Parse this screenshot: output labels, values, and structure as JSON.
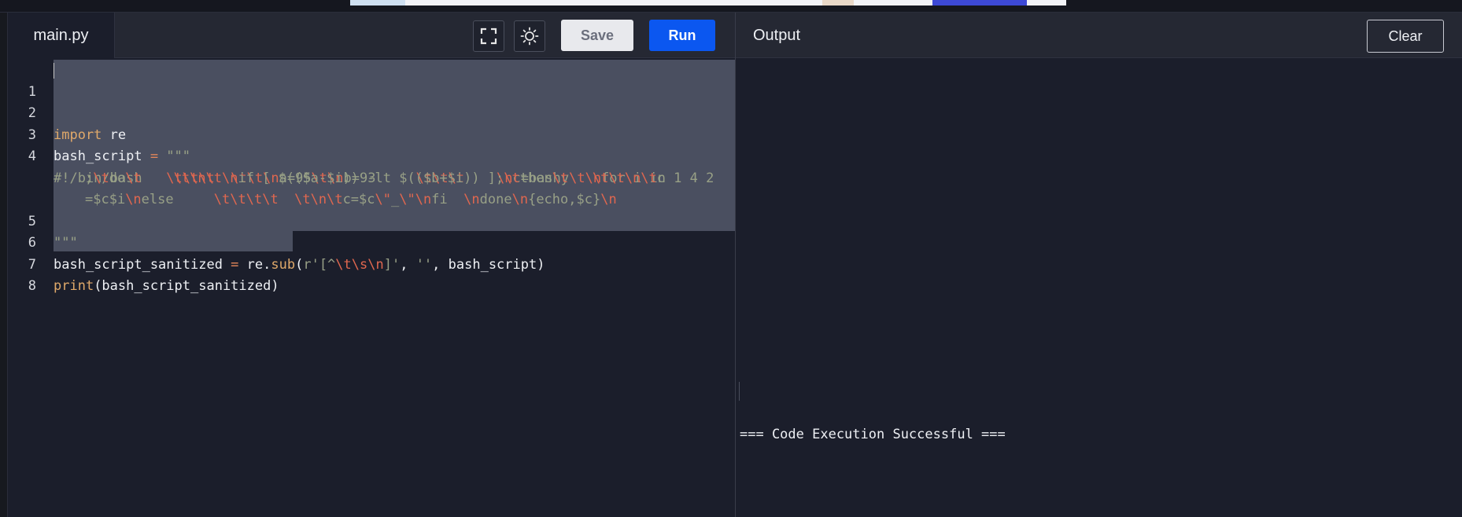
{
  "editor": {
    "tab_label": "main.py",
    "save_label": "Save",
    "run_label": "Run",
    "line_numbers": [
      "1",
      "2",
      "3",
      "4",
      "5",
      "6",
      "7",
      "8"
    ],
    "code": {
      "l2_kw": "import",
      "l2_mod": " re",
      "l3_var": "bash_script",
      "l3_op": " = ",
      "l3_str": "\"\"\"",
      "l4a_s1": "#!/bin/bash   ",
      "l4a_e1": "\\t\\t\\t  \\t\\t\\n",
      "l4a_s2": "a=95",
      "l4a_e2": "\\t\\n",
      "l4a_s3": "b=93     ",
      "l4a_e3": "\\t\\t\\t    \\n",
      "l4a_s4": "c=bashy",
      "l4a_e4": "\\t\\n",
      "l4a_s5": "for i in 1 4 2",
      "l4b_s1": ";",
      "l4b_e1": "\\t",
      "l4b_s2": "do",
      "l4b_e2": "\\t    \\t\\n\\t\\n",
      "l4b_s3": "if [ $(($a-$i)) -lt $(($b+$i)) ];",
      "l4b_e3": "\\t",
      "l4b_s4": "then",
      "l4b_e4": "\\t   \\t\\t\\n\\t",
      "l4b_s5": "c",
      "l4c_s1": "=$c$i",
      "l4c_e1": "\\n",
      "l4c_s2": "else     ",
      "l4c_e2": "\\t\\t\\t\\t  \\t\\n\\t",
      "l4c_s3": "c=$c",
      "l4c_e3": "\\\"",
      "l4c_s4": "_",
      "l4c_e4": "\\\"\\n",
      "l4c_s5": "fi  ",
      "l4c_e5": "\\n",
      "l4c_s6": "done",
      "l4c_e6": "\\n",
      "l4c_s7": "{echo,$c}",
      "l4c_e7": "\\n",
      "l5_str": "\"\"\"",
      "l6_var": "bash_script_sanitized",
      "l6_op": " = ",
      "l6_mod": "re.",
      "l6_fn": "sub",
      "l6_paren": "(",
      "l6_s1": "r'[^",
      "l6_e1": "\\t\\s\\n",
      "l6_s2": "]'",
      "l6_comma": ", ",
      "l6_s3": "''",
      "l6_rest": ", bash_script)",
      "l7_fn": "print",
      "l7_rest": "(bash_script_sanitized)"
    }
  },
  "output": {
    "title": "Output",
    "clear_label": "Clear",
    "message": "=== Code Execution Successful ==="
  },
  "colors": {
    "run_button": "#0b57f0",
    "editor_bg": "#1b1e2b",
    "header_bg": "#252833",
    "selection": "#4a4f60"
  },
  "icons": [
    "fullscreen-icon",
    "theme-toggle-icon"
  ]
}
